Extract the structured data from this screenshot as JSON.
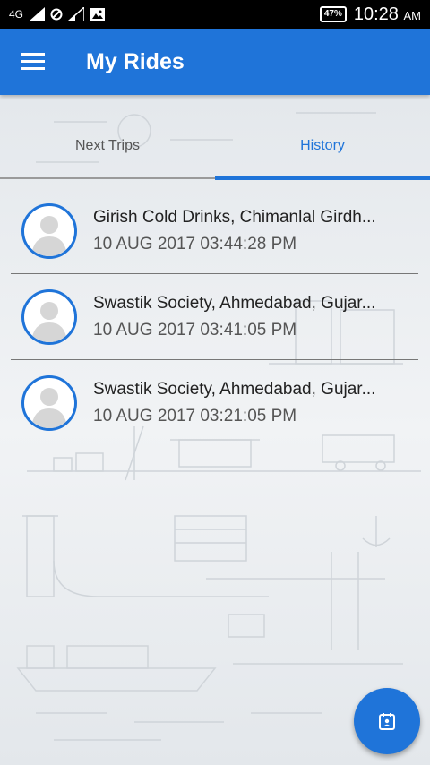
{
  "status_bar": {
    "network": "4G",
    "battery": "47%",
    "time": "10:28",
    "ampm": "AM"
  },
  "app_bar": {
    "title": "My Rides"
  },
  "tabs": [
    {
      "label": "Next Trips",
      "active": false
    },
    {
      "label": "History",
      "active": true
    }
  ],
  "rides": [
    {
      "title": "Girish Cold Drinks, Chimanlal Girdh...",
      "time": "10 AUG 2017 03:44:28 PM"
    },
    {
      "title": "Swastik Society, Ahmedabad, Gujar...",
      "time": "10 AUG 2017 03:41:05 PM"
    },
    {
      "title": "Swastik Society, Ahmedabad, Gujar...",
      "time": "10 AUG 2017 03:21:05 PM"
    }
  ],
  "colors": {
    "primary": "#1f74d9",
    "status_bar": "#000000",
    "background": "#eef1f4"
  }
}
